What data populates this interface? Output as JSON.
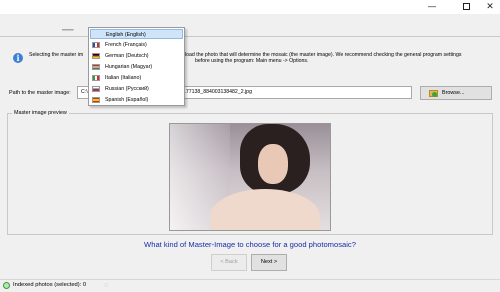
{
  "window": {
    "minimize_glyph": "—",
    "close_glyph": "✕",
    "tab_fragment": "▁▁▁"
  },
  "info": {
    "icon_glyph": "i",
    "text_prefix": "Selecting the master im",
    "line1": "load the photo that will determine the mosaic (the master image). We recommend checking the general program settings",
    "line2": "before using the program: Main menu -> Options."
  },
  "path": {
    "label": "Path to the master image:",
    "value_prefix": "C:\\U",
    "value_suffix": "177138_884003138482_2.jpg"
  },
  "browse": {
    "label": "Browse...",
    "icon": "folder-icon"
  },
  "preview": {
    "legend": "Master image preview"
  },
  "question": "What kind of Master-Image to choose for a good photomosaic?",
  "buttons": {
    "back": "< Back",
    "next": "Next >"
  },
  "status": {
    "text": "Indexed photos (selected): 0",
    "spinner_glyph": "◌"
  },
  "language_menu": {
    "items": [
      {
        "label": "English (English)",
        "selected": true,
        "flag": "none"
      },
      {
        "label": "French (Français)",
        "selected": false,
        "flag": "france-flag-icon"
      },
      {
        "label": "German (Deutsch)",
        "selected": false,
        "flag": "germany-flag-icon"
      },
      {
        "label": "Hungarian (Magyar)",
        "selected": false,
        "flag": "hungary-flag-icon"
      },
      {
        "label": "Italian (Italiano)",
        "selected": false,
        "flag": "italy-flag-icon"
      },
      {
        "label": "Russian (Русский)",
        "selected": false,
        "flag": "russia-flag-icon"
      },
      {
        "label": "Spanish (Español)",
        "selected": false,
        "flag": "spain-flag-icon"
      }
    ]
  },
  "colors": {
    "question_text": "#1c2da8",
    "selection_bg": "#cfe4f8",
    "info_icon": "#3b7fd6"
  }
}
